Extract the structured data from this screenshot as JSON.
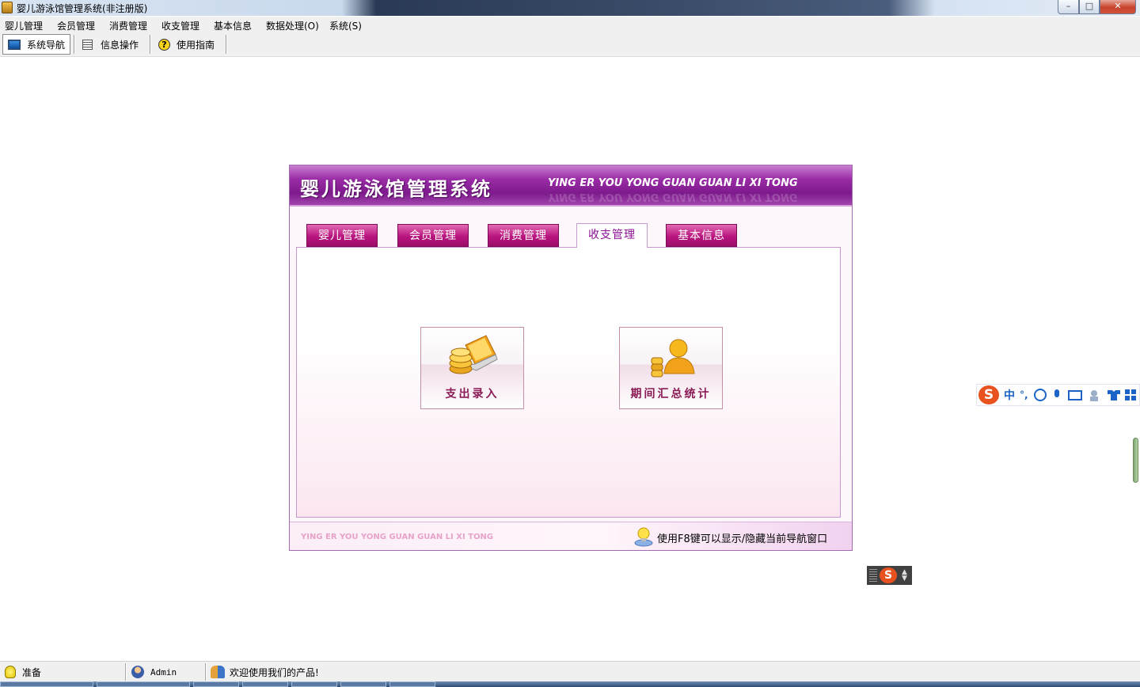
{
  "window": {
    "title": "婴儿游泳馆管理系统(非注册版)",
    "min_glyph": "–",
    "max_glyph": "□",
    "close_glyph": "✕"
  },
  "menu": [
    "婴儿管理",
    "会员管理",
    "消费管理",
    "收支管理",
    "基本信息",
    "数据处理(O)",
    "系统(S)"
  ],
  "toolbar": {
    "nav": "系统导航",
    "info": "信息操作",
    "help": "使用指南",
    "help_glyph": "?"
  },
  "panel": {
    "title_cn": "婴儿游泳馆管理系统",
    "title_en": "YING ER YOU YONG GUAN GUAN LI XI TONG",
    "tabs": [
      "婴儿管理",
      "会员管理",
      "消费管理",
      "收支管理",
      "基本信息"
    ],
    "active_tab": "收支管理",
    "buttons": [
      "支出录入",
      "期间汇总统计"
    ],
    "footer_en": "YING ER YOU YONG GUAN GUAN LI XI TONG",
    "footer_tip": "使用F8键可以显示/隐藏当前导航窗口"
  },
  "ime": {
    "logo": "S",
    "lang": "中",
    "punct": "°,"
  },
  "status": {
    "state": "准备",
    "user": "Admin",
    "message": "欢迎使用我们的产品!"
  },
  "colors": {
    "accent": "#9a2ca6",
    "tab": "#b8157e",
    "annotation_arrow": "#e03030"
  }
}
